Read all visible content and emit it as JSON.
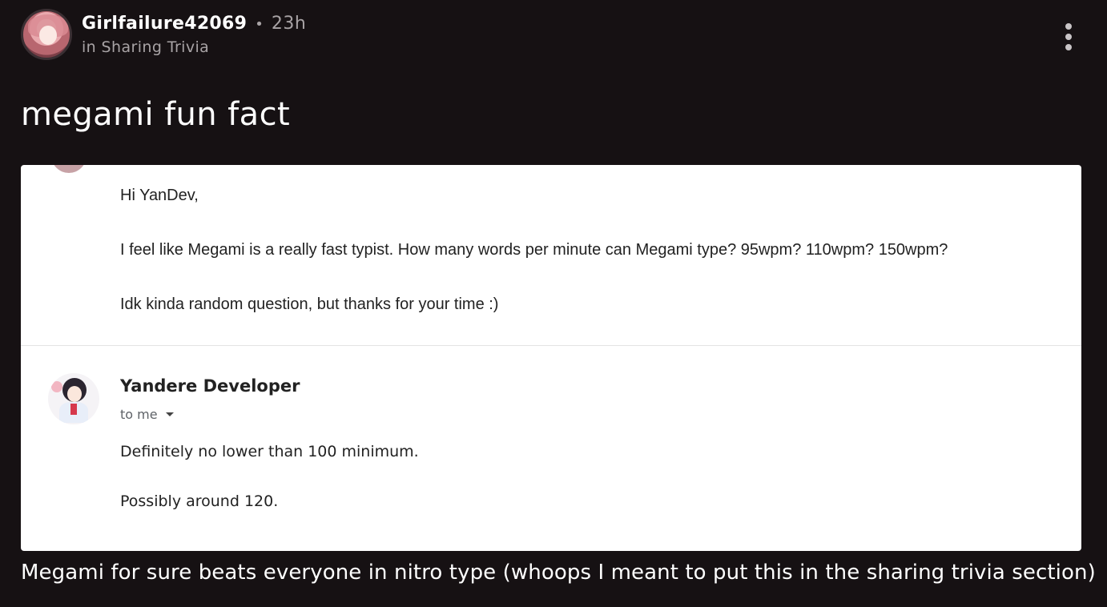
{
  "post": {
    "username": "Girlfailure42069",
    "separator": "•",
    "time_ago": "23h",
    "community": "in Sharing Trivia",
    "title": "megami fun fact",
    "caption": "Megami for sure beats everyone in nitro type (whoops I meant to put this in the sharing trivia section)"
  },
  "icons": {
    "avatar": "user-avatar-icon",
    "menu": "more-vertical-icon"
  },
  "email": {
    "message1": [
      "Hi YanDev,",
      "I feel like Megami is a really fast typist. How many words per minute can Megami type? 95wpm? 110wpm? 150wpm?",
      "Idk kinda random question, but thanks for your time :)"
    ],
    "reply_sender": "Yandere Developer",
    "reply_recipient": "to me",
    "reply_lines": [
      "Definitely no lower than 100 minimum.",
      "Possibly around 120."
    ]
  },
  "colors": {
    "background": "#161113",
    "muted_text": "#a8a3a5",
    "email_bg": "#ffffff"
  }
}
